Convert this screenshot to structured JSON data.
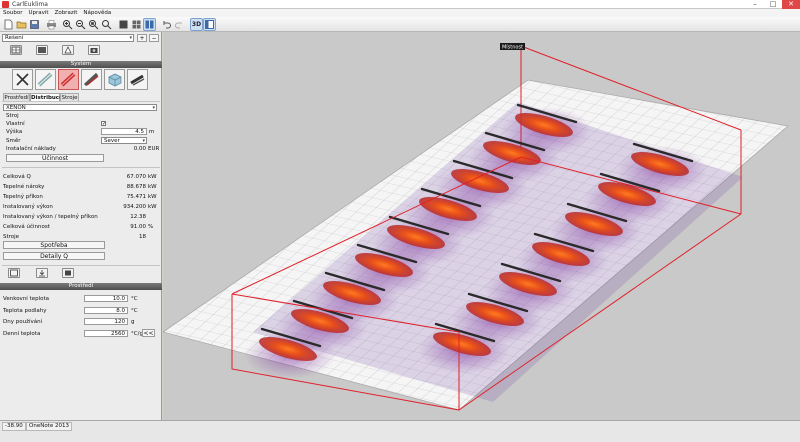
{
  "window": {
    "title": "CarlEuklima"
  },
  "window_buttons": [
    "–",
    "□",
    "✕"
  ],
  "menu": [
    "Soubor",
    "Upravit",
    "Zobrazit",
    "Nápověda"
  ],
  "toolbar": {
    "view_3d": "3D"
  },
  "left": {
    "scene_select": "Řešení",
    "system_header": "Systém",
    "tabs": [
      "Prostředí",
      "Distribuce",
      "Stroje"
    ],
    "active_tab": "Distribuce",
    "distribution": {
      "product_select": "XENON",
      "group_label": "Stroj",
      "own_label": "Vlastní",
      "own_checked": "✓",
      "height_label": "Výška",
      "height_value": "4.5",
      "height_unit": "m",
      "direction_label": "Směr",
      "direction_value": "Sever",
      "install_cost_label": "Instalační náklady",
      "install_cost_value": "0.00",
      "install_cost_unit": "EUR",
      "efficiency_button": "Účinnost"
    },
    "results": [
      {
        "label": "Celková Q",
        "value": "67.070",
        "unit": "kW"
      },
      {
        "label": "Tepelné nároky",
        "value": "88.678",
        "unit": "kW"
      },
      {
        "label": "Tepelný příkon",
        "value": "75.471",
        "unit": "kW"
      },
      {
        "label": "Instalovaný výkon",
        "value": "934.200",
        "unit": "kW"
      },
      {
        "label": "Instalovaný výkon / tepelný příkon",
        "value": "12.38",
        "unit": ""
      },
      {
        "label": "Celková účinnost",
        "value": "91.00",
        "unit": "%"
      },
      {
        "label": "Stroje",
        "value": "18",
        "unit": ""
      }
    ],
    "consumption_button": "Spotřeba",
    "details_button": "Detaily Q",
    "environment_header": "Prostředí",
    "environment": [
      {
        "label": "Venkovní teplota",
        "value": "10.0",
        "unit": "°C"
      },
      {
        "label": "Teplota podlahy",
        "value": "8.0",
        "unit": "°C"
      },
      {
        "label": "Dny používání",
        "value": "120",
        "unit": "g"
      },
      {
        "label": "Denní teplota",
        "value": "2560",
        "unit": "°C/g"
      }
    ],
    "back_button": "<<"
  },
  "viewport": {
    "room_label": "Místnost"
  },
  "status": {
    "coord": "-38.90",
    "tag": "OneNote 2013"
  },
  "colors": {
    "room_outline": "#e0202a",
    "heat_core": "#e8501a",
    "floor": "#f4f4f4"
  }
}
